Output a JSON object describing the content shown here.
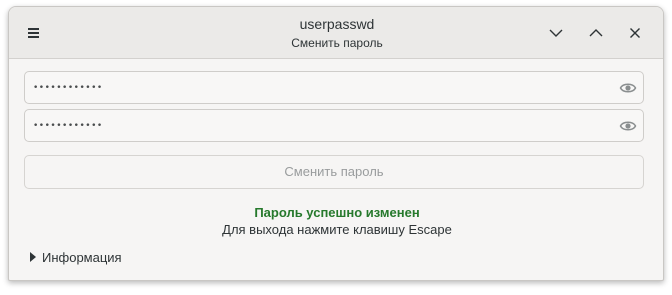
{
  "window": {
    "title": "userpasswd",
    "subtitle": "Сменить пароль"
  },
  "header": {
    "menu_icon": "hamburger-menu-icon",
    "controls": [
      "chevron-down-icon",
      "chevron-up-icon",
      "close-icon"
    ]
  },
  "form": {
    "password_field": {
      "value": "••••••••••••",
      "reveal_icon": "eye-icon"
    },
    "confirm_field": {
      "value": "••••••••••••",
      "reveal_icon": "eye-icon"
    },
    "submit_label": "Сменить пароль"
  },
  "status": {
    "success": "Пароль успешно изменен",
    "hint": "Для выхода нажмите клавишу Escape"
  },
  "expander": {
    "label": "Информация",
    "icon": "triangle-right-icon"
  },
  "colors": {
    "success": "#26792c",
    "headerbar": "#ebeae8",
    "window_bg": "#f6f5f4"
  }
}
